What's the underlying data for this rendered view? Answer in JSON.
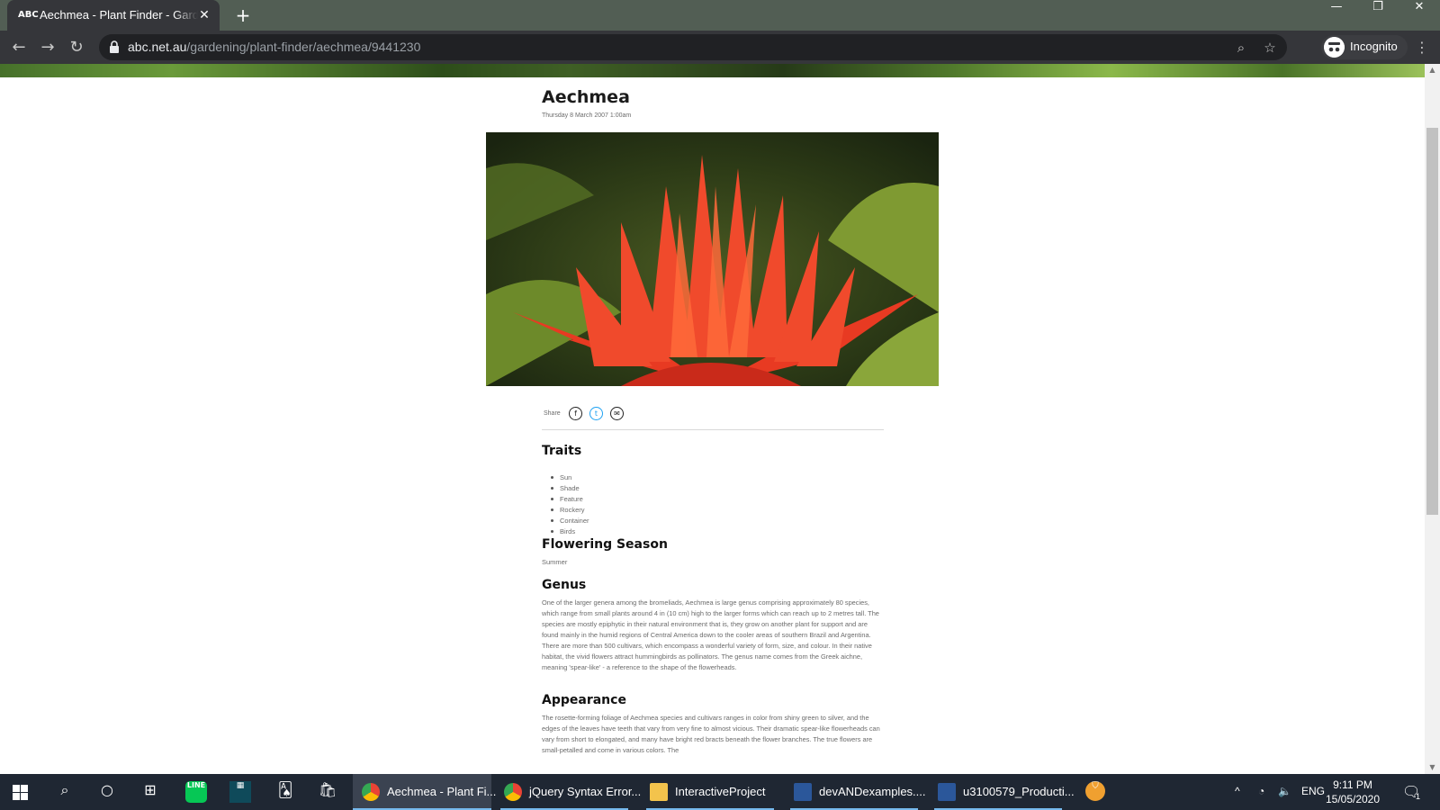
{
  "browser": {
    "tab_title": "Aechmea - Plant Finder - Gardening",
    "favicon_text": "ABC",
    "url_host": "abc.net.au",
    "url_path": "/gardening/plant-finder/aechmea/9441230",
    "profile_label": "Incognito"
  },
  "article": {
    "title": "Aechmea",
    "date": "Thursday 8 March 2007 1:00am",
    "share_label": "Share",
    "traits_heading": "Traits",
    "traits": [
      "Sun",
      "Shade",
      "Feature",
      "Rockery",
      "Container",
      "Birds"
    ],
    "flowering_heading": "Flowering Season",
    "flowering_value": "Summer",
    "genus_heading": "Genus",
    "genus_text": "One of the larger genera among the bromeliads, Aechmea is large genus comprising approximately 80 species, which range from small plants around 4 in (10 cm) high to the larger forms which can reach up to 2 metres tall. The species are mostly epiphytic in their natural environment that is, they grow on another plant for support and are found mainly in the humid regions of Central America down to the cooler areas of southern Brazil and Argentina. There are more than 500 cultivars, which encompass a wonderful variety of form, size, and colour. In their native habitat, the vivid flowers attract hummingbirds as pollinators. The genus name comes from the Greek aichne, meaning 'spear-like' - a reference to the shape of the flowerheads.",
    "appearance_heading": "Appearance",
    "appearance_text": "The rosette-forming foliage of Aechmea species and cultivars ranges in color from shiny green to silver, and the edges of the leaves have teeth that vary from very fine to almost vicious. Their dramatic spear-like flowerheads can vary from short to elongated, and many have bright red bracts beneath the flower branches. The true flowers are small-petalled and come in various colors. The"
  },
  "taskbar": {
    "apps": [
      {
        "label": "Aechmea - Plant Fi..."
      },
      {
        "label": "jQuery Syntax Error..."
      },
      {
        "label": "InteractiveProject"
      },
      {
        "label": "devANDexamples...."
      },
      {
        "label": "u3100579_Producti..."
      }
    ],
    "language": "ENG",
    "time": "9:11 PM",
    "date": "15/05/2020",
    "notification_count": "1"
  }
}
